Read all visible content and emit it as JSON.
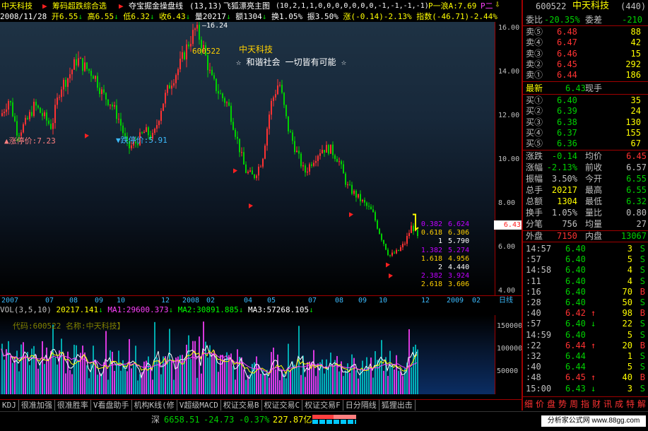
{
  "top_bar": {
    "stock_name": "中天科技",
    "indicator1": "筹码超跌综合选",
    "indicator2": "夺宝掘金操盘线",
    "indicator2_params": "(13,13)",
    "main_chart_name": "飞狐漂亮主图",
    "main_chart_params": "(10,2,1,1,0,0,0,0,0,0,0,-1,-1,-1,-1)",
    "signal": "P一浪A:7.69",
    "signal2": "P二",
    "icon": "lock-icon"
  },
  "info_bar": {
    "date": "2008/11/28",
    "open": "开6.55",
    "high": "高6.55",
    "low": "低6.32",
    "close": "收6.43",
    "volume": "量20217",
    "amount": "额1304",
    "turnover": "换1.05%",
    "amplitude": "振3.50%",
    "change": "涨(-0.14)-2.13%",
    "index": "指数(-46.71)-2.44%"
  },
  "chart_data": {
    "type": "candlestick",
    "price_axis": {
      "ticks": [
        "16.00",
        "14.00",
        "12.00",
        "10.00",
        "8.00",
        "6.00",
        "4.00"
      ],
      "range": [
        3.8,
        16.3
      ]
    },
    "date_axis": [
      "2007",
      "07",
      "08",
      "09",
      "10",
      "12",
      "2008",
      "02",
      "04",
      "05",
      "07",
      "08",
      "09",
      "10",
      "12",
      "2009",
      "02"
    ],
    "period_label": "日线",
    "annotations": {
      "peak_high": "16.24",
      "code_label": "600522",
      "name_label": "中天科技",
      "slogan": "☆ 和谐社会  一切皆有可能 ☆",
      "limit_up": "▲涨停价:7.23",
      "limit_down": "▼跌停价:5.91",
      "current_price": "6.43"
    },
    "fib_levels": [
      {
        "label": "0.382",
        "value": "6.624",
        "color": "#c000ff"
      },
      {
        "label": "0.618",
        "value": "6.306",
        "color": "#ffd000"
      },
      {
        "label": "1",
        "value": "5.790",
        "color": "#ffffff"
      },
      {
        "label": "1.382",
        "value": "5.274",
        "color": "#c000ff"
      },
      {
        "label": "1.618",
        "value": "4.956",
        "color": "#ffd000"
      },
      {
        "label": "2",
        "value": "4.440",
        "color": "#ffffff"
      },
      {
        "label": "2.382",
        "value": "3.924",
        "color": "#c000ff"
      },
      {
        "label": "2.618",
        "value": "3.606",
        "color": "#ffd000"
      }
    ],
    "price_path": [
      [
        0,
        12.0
      ],
      [
        12,
        12.8
      ],
      [
        24,
        11.2
      ],
      [
        36,
        11.7
      ],
      [
        48,
        12.5
      ],
      [
        60,
        12.0
      ],
      [
        72,
        11.5
      ],
      [
        84,
        13.3
      ],
      [
        96,
        13.8
      ],
      [
        108,
        14.6
      ],
      [
        120,
        14.2
      ],
      [
        132,
        13.9
      ],
      [
        144,
        13.0
      ],
      [
        156,
        12.6
      ],
      [
        168,
        11.8
      ],
      [
        180,
        10.5
      ],
      [
        192,
        10.8
      ],
      [
        204,
        11.3
      ],
      [
        216,
        11.0
      ],
      [
        228,
        12.5
      ],
      [
        240,
        13.5
      ],
      [
        252,
        14.2
      ],
      [
        264,
        15.2
      ],
      [
        276,
        16.0
      ],
      [
        286,
        15.2
      ],
      [
        298,
        13.7
      ],
      [
        310,
        13.0
      ],
      [
        322,
        12.5
      ],
      [
        334,
        11.0
      ],
      [
        346,
        9.5
      ],
      [
        358,
        9.2
      ],
      [
        370,
        10.0
      ],
      [
        382,
        12.5
      ],
      [
        394,
        13.6
      ],
      [
        406,
        11.5
      ],
      [
        418,
        10.4
      ],
      [
        430,
        9.4
      ],
      [
        442,
        10.0
      ],
      [
        454,
        10.5
      ],
      [
        466,
        10.5
      ],
      [
        478,
        10.0
      ],
      [
        490,
        8.8
      ],
      [
        502,
        8.4
      ],
      [
        514,
        8.0
      ],
      [
        526,
        7.6
      ],
      [
        538,
        6.5
      ],
      [
        550,
        5.6
      ],
      [
        562,
        5.8
      ],
      [
        572,
        6.2
      ],
      [
        582,
        7.0
      ],
      [
        590,
        6.43
      ]
    ],
    "volume_axis": {
      "ticks": [
        "150000",
        "100000",
        "50000"
      ],
      "max": 175000
    },
    "volume_indicator": {
      "label": "VOL(3,5,10)",
      "vol": "20217.141",
      "ma1": "MA1:29600.373",
      "ma2": "MA2:30891.885",
      "ma3": "MA3:57268.105"
    },
    "volume_overlay_text": "代码:600522 名称:中天科技】"
  },
  "tabs": [
    "KDJ",
    "很准加强",
    "很准胜率",
    "V看盘助手",
    "机构K线(修",
    "V超级MACD",
    "权证交易B",
    "权证交易C",
    "权证交易F",
    "日分隔线",
    "狐狸出击"
  ],
  "quote_panel": {
    "code": "600522",
    "name": "中天科技",
    "number": "(440)",
    "webi_label": "委比",
    "webi_value": "-20.35%",
    "weicha_label": "委差",
    "weicha_value": "-210",
    "asks": [
      {
        "label": "卖⑤",
        "price": "6.48",
        "vol": "88"
      },
      {
        "label": "卖④",
        "price": "6.47",
        "vol": "42"
      },
      {
        "label": "卖③",
        "price": "6.46",
        "vol": "15"
      },
      {
        "label": "卖②",
        "price": "6.45",
        "vol": "292"
      },
      {
        "label": "卖①",
        "price": "6.44",
        "vol": "186"
      }
    ],
    "last_label": "最新",
    "last_price": "6.43",
    "hand_label": "现手",
    "bids": [
      {
        "label": "买①",
        "price": "6.40",
        "vol": "35"
      },
      {
        "label": "买②",
        "price": "6.39",
        "vol": "24"
      },
      {
        "label": "买③",
        "price": "6.38",
        "vol": "130"
      },
      {
        "label": "买④",
        "price": "6.37",
        "vol": "155"
      },
      {
        "label": "买⑤",
        "price": "6.36",
        "vol": "67"
      }
    ],
    "stats": [
      {
        "l1": "涨跌",
        "v1": "-0.14",
        "l2": "均价",
        "v2": "6.45"
      },
      {
        "l1": "涨幅",
        "v1": "-2.13%",
        "l2": "前收",
        "v2": "6.57"
      },
      {
        "l1": "振幅",
        "v1": "3.50%",
        "l2": "今开",
        "v2": "6.55"
      },
      {
        "l1": "总手",
        "v1": "20217",
        "l2": "最高",
        "v2": "6.55"
      },
      {
        "l1": "总额",
        "v1": "1304",
        "l2": "最低",
        "v2": "6.32"
      },
      {
        "l1": "换手",
        "v1": "1.05%",
        "l2": "量比",
        "v2": "0.80"
      },
      {
        "l1": "分笔",
        "v1": "756",
        "l2": "均量",
        "v2": "27"
      }
    ],
    "outer_label": "外盘",
    "outer_value": "7150",
    "inner_label": "内盘",
    "inner_value": "13067",
    "ticks": [
      {
        "time": "14:57",
        "price": "6.40",
        "arrow": "",
        "vol": "3",
        "side": "S"
      },
      {
        "time": ":57",
        "price": "6.40",
        "arrow": "",
        "vol": "5",
        "side": "S"
      },
      {
        "time": "14:58",
        "price": "6.40",
        "arrow": "",
        "vol": "4",
        "side": "S"
      },
      {
        "time": ":11",
        "price": "6.40",
        "arrow": "",
        "vol": "4",
        "side": "S"
      },
      {
        "time": ":16",
        "price": "6.40",
        "arrow": "",
        "vol": "70",
        "side": "B"
      },
      {
        "time": ":28",
        "price": "6.40",
        "arrow": "",
        "vol": "50",
        "side": "S"
      },
      {
        "time": ":40",
        "price": "6.42",
        "arrow": "↑",
        "vol": "98",
        "side": "B"
      },
      {
        "time": ":57",
        "price": "6.40",
        "arrow": "↓",
        "vol": "22",
        "side": "S"
      },
      {
        "time": "14:59",
        "price": "6.40",
        "arrow": "",
        "vol": "5",
        "side": "S"
      },
      {
        "time": ":22",
        "price": "6.44",
        "arrow": "↑",
        "vol": "20",
        "side": "B"
      },
      {
        "time": ":32",
        "price": "6.44",
        "arrow": "",
        "vol": "1",
        "side": "S"
      },
      {
        "time": ":40",
        "price": "6.44",
        "arrow": "",
        "vol": "5",
        "side": "S"
      },
      {
        "time": ":48",
        "price": "6.45",
        "arrow": "↑",
        "vol": "40",
        "side": "B"
      },
      {
        "time": "15:00",
        "price": "6.43",
        "arrow": "↓",
        "vol": "3",
        "side": "S"
      }
    ],
    "bottom_tabs": [
      "细",
      "价",
      "盘",
      "势",
      "周",
      "指",
      "财",
      "讯",
      "成",
      "特",
      "解"
    ]
  },
  "status_bar": {
    "market": "深",
    "index_value": "6658.51",
    "index_change": "-24.73",
    "index_pct": "-0.37%",
    "amount": "227.87亿",
    "watermark": "分析家公式网 www.88gg.com"
  },
  "colors": {
    "up": "#ff3232",
    "down": "#00d000",
    "accent": "#ffff00",
    "axis": "#a00000",
    "cyan": "#3cbcff"
  }
}
